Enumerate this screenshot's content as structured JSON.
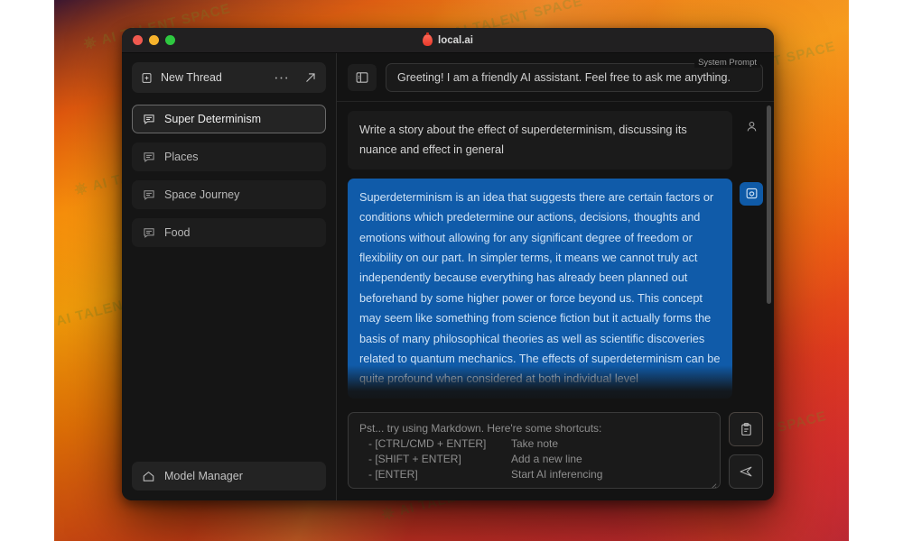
{
  "window": {
    "title": "local.ai",
    "title_icon": "flame-icon",
    "controls": {
      "close": "close-window-button",
      "minimize": "minimize-window-button",
      "maximize": "maximize-window-button"
    }
  },
  "sidebar": {
    "new_thread": {
      "label": "New Thread",
      "icon": "file-plus-icon",
      "more_icon": "ellipsis-icon",
      "expand_icon": "arrow-up-right-icon"
    },
    "threads": [
      {
        "label": "Super Determinism",
        "icon": "message-icon",
        "active": true
      },
      {
        "label": "Places",
        "icon": "message-icon",
        "active": false
      },
      {
        "label": "Space Journey",
        "icon": "message-icon",
        "active": false
      },
      {
        "label": "Food",
        "icon": "message-icon",
        "active": false
      }
    ],
    "model_manager": {
      "label": "Model Manager",
      "icon": "home-icon"
    }
  },
  "topbar": {
    "panel_toggle_icon": "sidebar-panel-icon",
    "system_prompt_label": "System Prompt",
    "system_prompt_value": "Greeting! I am a friendly AI assistant. Feel free to ask me anything."
  },
  "messages": [
    {
      "role": "user",
      "avatar_icon": "user-icon",
      "text": "Write a story about the effect of superdeterminism, discussing its nuance and effect in general"
    },
    {
      "role": "ai",
      "avatar_icon": "bot-icon",
      "text": "Superdeterminism is an idea that suggests there are certain factors or conditions which predetermine our actions, decisions, thoughts and emotions without allowing for any significant degree of freedom or flexibility on our part. In simpler terms, it means we cannot truly act independently because everything has already been planned out beforehand by some higher power or force beyond us. This concept may seem like something from science fiction but it actually forms the basis of many philosophical theories as well as scientific discoveries related to quantum mechanics. The effects of superdeterminism can be quite profound when considered at both individual level"
    }
  ],
  "composer": {
    "placeholder_title": "Pst... try using Markdown. Here're some shortcuts:",
    "shortcuts": [
      {
        "keys": "   - [CTRL/CMD + ENTER]",
        "action": "Take note"
      },
      {
        "keys": "   - [SHIFT + ENTER]",
        "action": "Add a new line"
      },
      {
        "keys": "   - [ENTER]",
        "action": "Start AI inferencing"
      }
    ],
    "note_button_icon": "clipboard-note-icon",
    "send_button_icon": "send-paper-plane-icon",
    "resize_grip_icon": "resize-grip-icon"
  },
  "colors": {
    "accent_blue": "#105ba9",
    "window_bg": "#131313",
    "sidebar_bg": "#151515",
    "titlebar_bg": "#212021",
    "wallpaper_orange": "#f58a0a",
    "wallpaper_red": "#d22a2c"
  },
  "watermarks": [
    "AI TALENT SPACE",
    "AI TALENT SPACE",
    "AI TALENT SPACE",
    "AI TALENT SPACE",
    "AI TALENT SPACE",
    "AI TALENT SPACE",
    "AI TALENT SPACE",
    "AI TALENT SPACE",
    "AI TALENT SPACE",
    "AI TALENT SPACE"
  ]
}
